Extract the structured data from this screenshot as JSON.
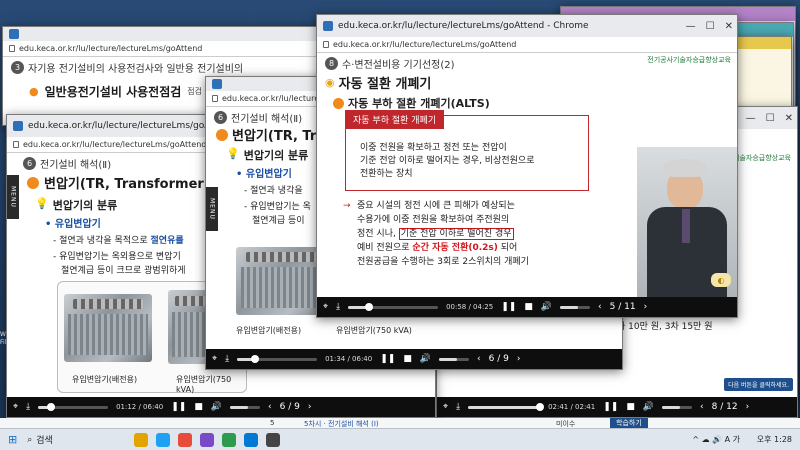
{
  "browser": {
    "name": "Chrome"
  },
  "url_full": "edu.keca.or.kr/lu/lecture/lectureLms/goAttend",
  "url_title": "edu.keca.or.kr/lu/lecture/lectureLms/goAttend - Chrome",
  "desktop": {
    "left_label1": "Wonde",
    "left_label2": "Filmor"
  },
  "back1": {
    "lesson_num": "3",
    "lesson_title": "자기용 전기설비의 사용전검사와 일반용 전기설비의",
    "heading": "일반용전기설비 사용전점검",
    "heading_extra": "점검 범위 및"
  },
  "back2": {
    "lesson_num": "6",
    "lesson_title": "전기설비 해석(Ⅱ)",
    "heading": "변압기(TR, Transformer)",
    "sub": "변압기의 분류",
    "bullet": "유입변압기",
    "line1": "절연과 냉각을 목적으로",
    "line1_hl": "절연유를",
    "line2": "유입변압기는 옥외용으로 변압기",
    "line3": "절연계급 등이 크므로 광범위하게",
    "img1_caption": "유입변압기(배전용)",
    "img2_caption": "유입변압기(750 kVA)",
    "time": "01:12 / 06:40",
    "page": "6 / 9",
    "progress_pct": 18
  },
  "mid": {
    "lesson_num": "6",
    "lesson_title": "전기설비 해석(Ⅱ)",
    "heading": "변압기(TR, Tr",
    "sub": "변압기의 분류",
    "bullet": "유입변압기",
    "line1": "절연과 냉각을",
    "line2": "유입변압기는 옥",
    "line3": "절연계급 등이",
    "img1_caption": "유입변압기(배전용)",
    "img2_caption": "유입변압기(750 kVA)",
    "time": "01:34 / 06:40",
    "page": "6 / 9",
    "progress_pct": 23
  },
  "front": {
    "lesson_num": "8",
    "lesson_title": "수·변전설비용 기기선정(2)",
    "brand": "전기공사기술자승급향상교육",
    "heading": "자동 절환 개폐기",
    "sub": "자동 부하 절환 개폐기(ALTS)",
    "box_title": "자동 부하 절환 개폐기",
    "box_text1": "이중 전원을 확보하고 정전 또는 전압이",
    "box_text2": "기준 전압 이하로 떨어지는 경우, 비상전원으로",
    "box_text3": "전환하는 장치",
    "para1": "중요 시설의 정전 시에 큰 피해가 예상되는",
    "para2": "수용가에 이중 전원을 확보하여 주전원의",
    "para3": "정전 시나,",
    "para3_hl": "기준 전압 이하로 떨어진 경우",
    "para4a": "예비 전원으로",
    "para4_hl": "순간 자동 전환(0.2s)",
    "para4b": "되어",
    "para5": "전원공급을 수행하는 3회로 2스위치의 개폐기",
    "time": "00:58 / 04:25",
    "page": "5 / 11",
    "progress_pct": 23
  },
  "right": {
    "brand": "전기공사기술자승급향상교육",
    "text": "차 10만 원, 3차 15만 원",
    "next_btn": "다음 버튼을 클릭하세요.",
    "time": "02:41 / 02:41",
    "page": "8 / 12",
    "progress_pct": 100
  },
  "statusbar": {
    "num": "5",
    "title": "5차시 · 전기설비 해석 (Ⅰ)",
    "status": "미이수",
    "action": "학습하기"
  },
  "taskbar": {
    "search": "검색",
    "time": "오후 1:28",
    "tray": "^  ☁  🔊  A  가"
  },
  "colors": {
    "accent_red": "#c0272d",
    "accent_orange": "#f08a1c",
    "highlight_red": "#d0161b",
    "brand_green": "#1f7a3a"
  },
  "icons": [
    "search-icon",
    "lock-icon",
    "play-icon",
    "pause-icon",
    "download-icon",
    "volume-icon",
    "location-icon",
    "menu-icon",
    "chevron-left-icon",
    "chevron-right-icon",
    "minimize-icon",
    "maximize-icon",
    "close-icon",
    "windows-icon"
  ]
}
